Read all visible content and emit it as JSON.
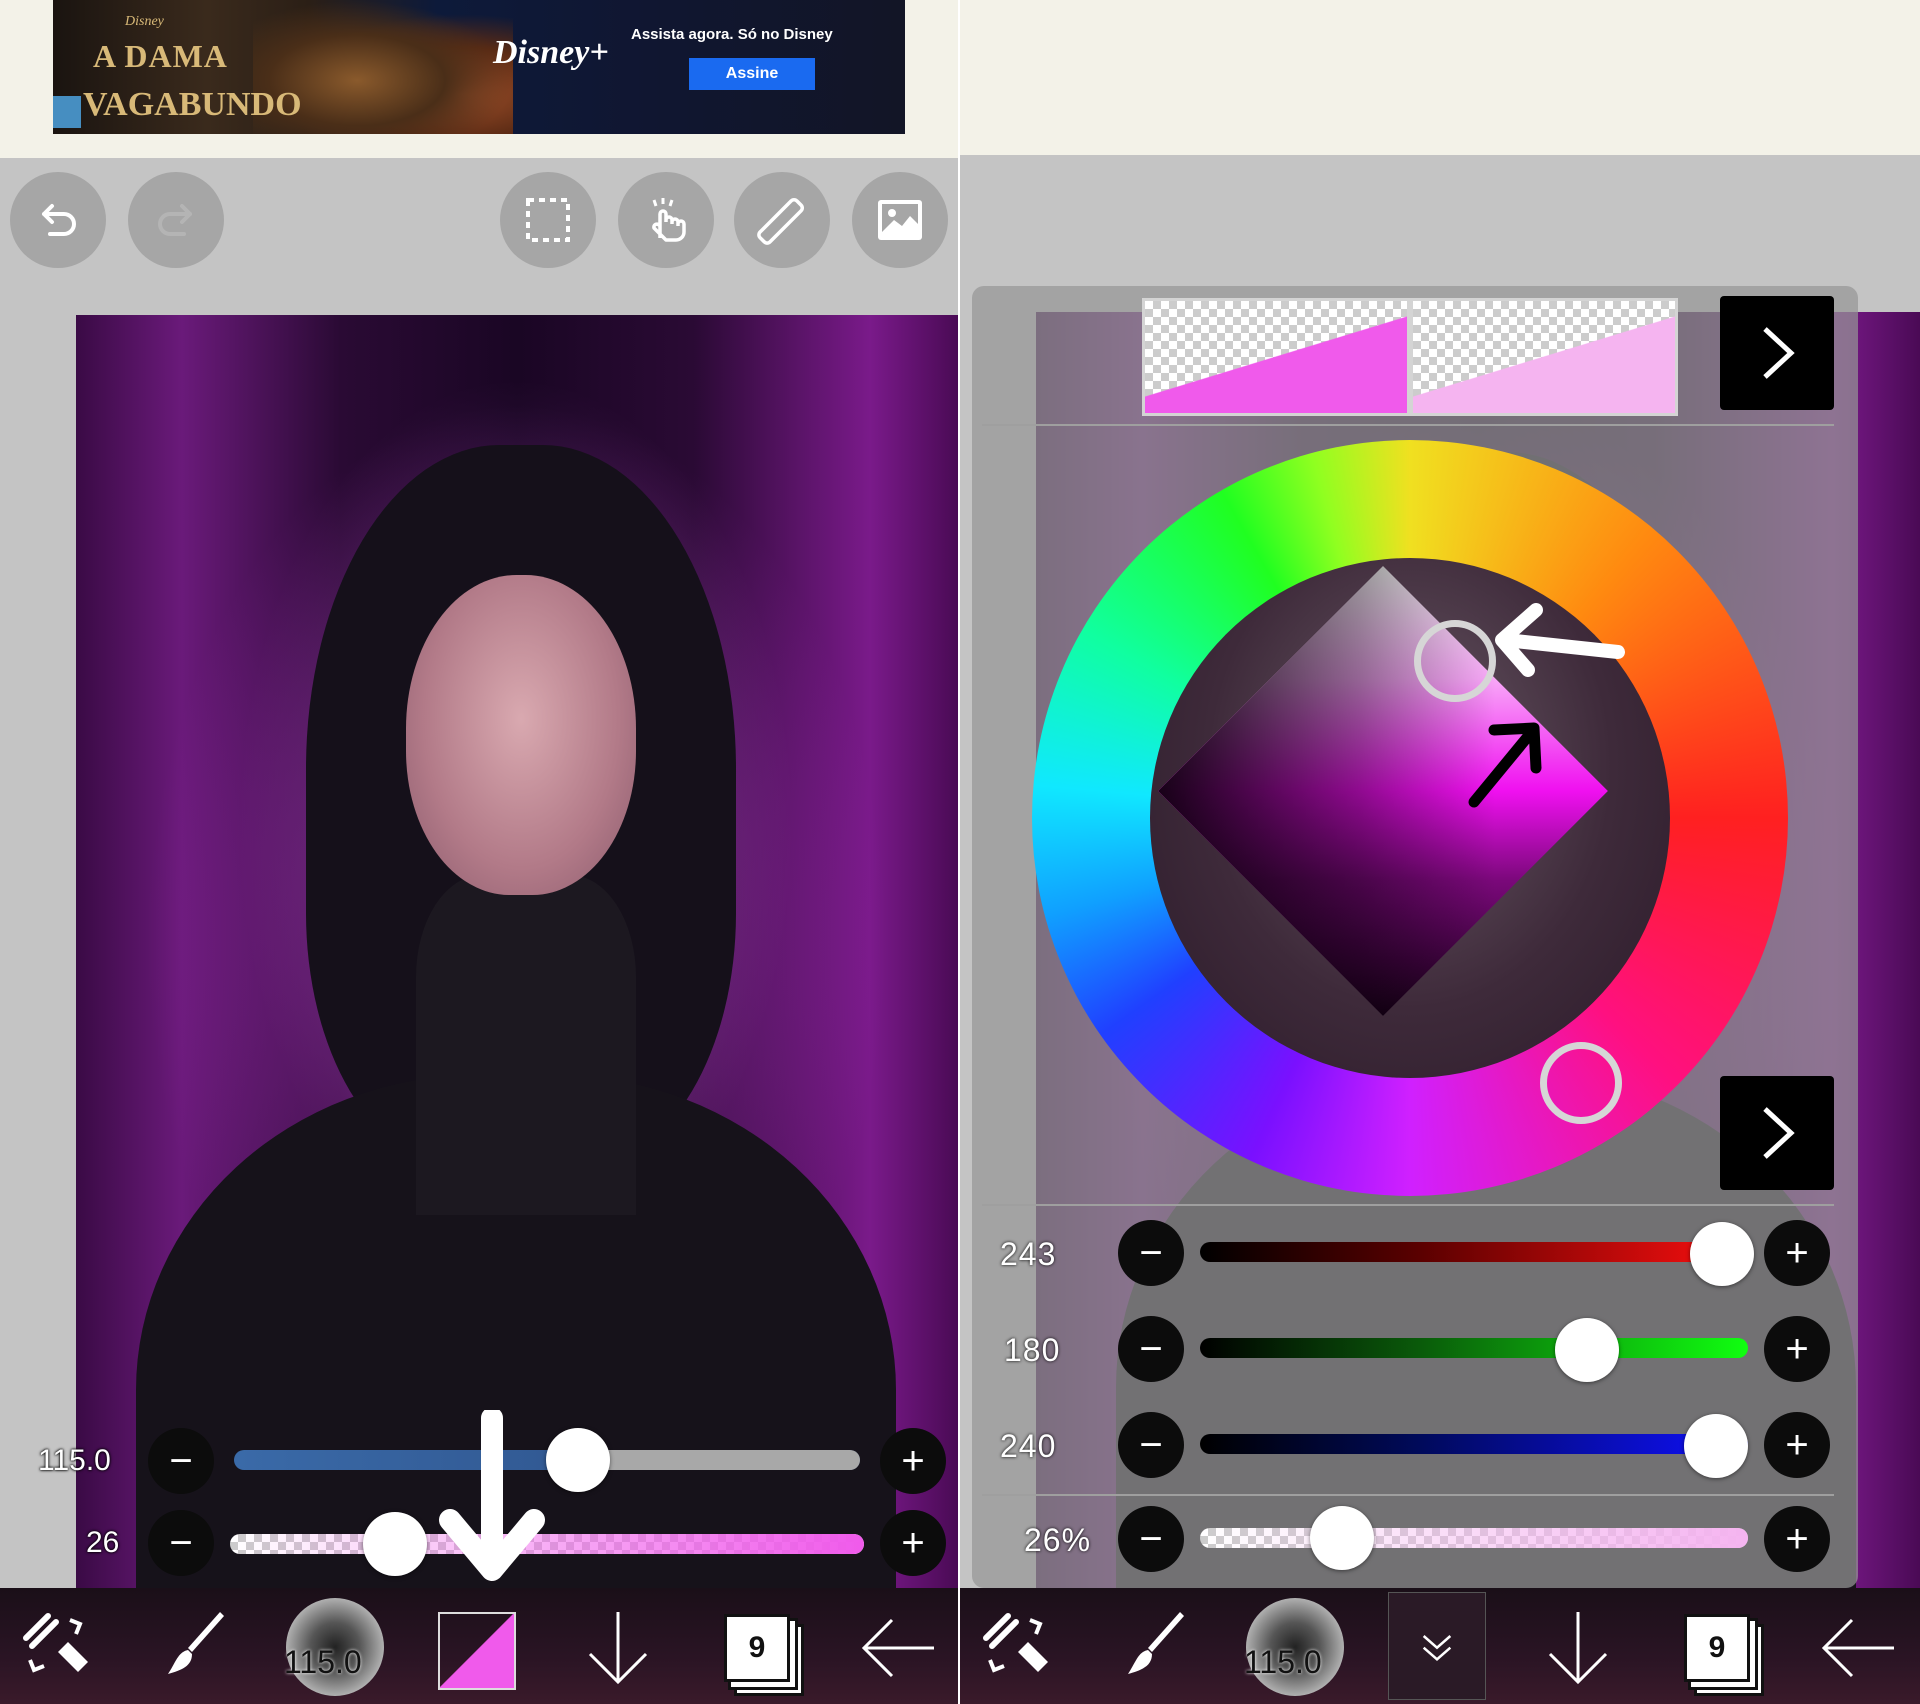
{
  "ad": {
    "small_brand": "Disney",
    "title_line1": "A DAMA",
    "title_line2": "VAGABUNDO",
    "brand": "Disney+",
    "headline": "Assista agora. Só no Disney",
    "cta": "Assine"
  },
  "colors": {
    "foreground": "#f05aeb",
    "background": "#f5b4f0",
    "accent_dark": "#0c0c0c"
  },
  "left": {
    "toolbar": {
      "undo": "undo-icon",
      "redo": "redo-icon",
      "selection": "selection-icon",
      "hand": "hand-icon",
      "ruler": "ruler-icon",
      "image": "image-icon"
    },
    "brush_size": {
      "value": "115.0",
      "fraction": 0.55
    },
    "opacity": {
      "value": "26",
      "fraction": 0.26
    },
    "bottom": {
      "brush_size_label": "115.0",
      "layer_count": "9"
    }
  },
  "right": {
    "rgb": {
      "r": {
        "value": "243",
        "fraction": 0.953
      },
      "g": {
        "value": "180",
        "fraction": 0.706
      },
      "b": {
        "value": "240",
        "fraction": 0.941
      }
    },
    "alpha": {
      "value": "26%",
      "fraction": 0.26
    },
    "bottom": {
      "brush_size_label": "115.0",
      "layer_count": "9"
    }
  }
}
